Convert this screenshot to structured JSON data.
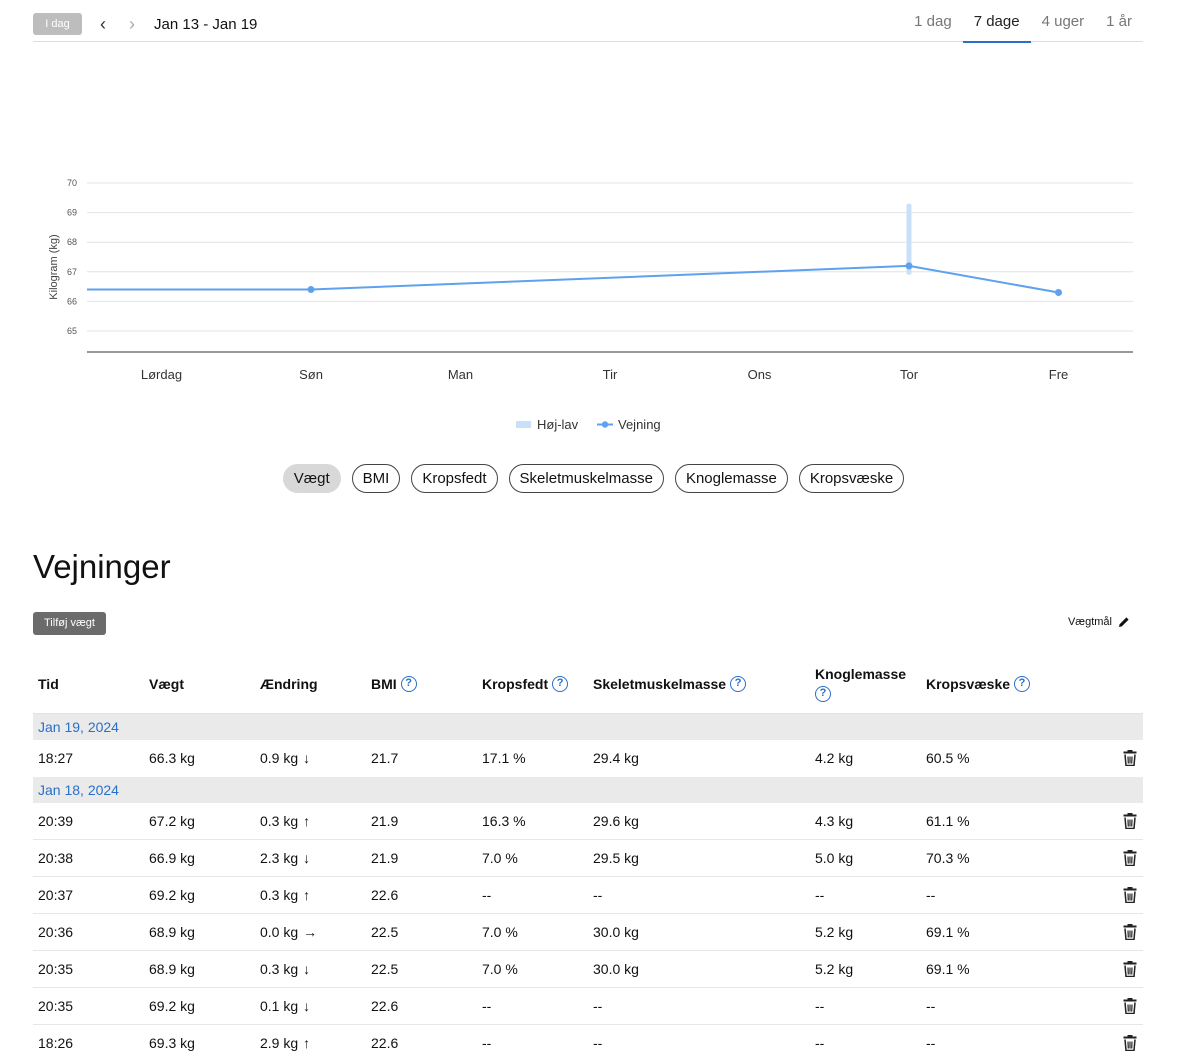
{
  "header": {
    "today_label": "I dag",
    "date_range": "Jan 13 - Jan 19",
    "range_tabs": [
      {
        "label": "1 dag",
        "active": false
      },
      {
        "label": "7 dage",
        "active": true
      },
      {
        "label": "4 uger",
        "active": false
      },
      {
        "label": "1 år",
        "active": false
      }
    ]
  },
  "chart_data": {
    "type": "line",
    "ylabel": "Kilogram (kg)",
    "ylim": [
      64.4,
      70.4
    ],
    "yticks": [
      65,
      66,
      67,
      68,
      69,
      70
    ],
    "categories": [
      "Lørdag",
      "Søn",
      "Man",
      "Tir",
      "Ons",
      "Tor",
      "Fre"
    ],
    "series": [
      {
        "name": "Vejning",
        "color": "#5ea1ee",
        "points": [
          {
            "x": "Søn",
            "y": 66.4
          },
          {
            "x": "Tor",
            "y": 67.2
          },
          {
            "x": "Fre",
            "y": 66.3
          }
        ],
        "carry_left": 66.4
      },
      {
        "name": "Høj-lav",
        "color": "#c9e0fa",
        "ranges": [
          {
            "x": "Tor",
            "low": 66.9,
            "high": 69.3
          }
        ]
      }
    ],
    "legend": [
      "Høj-lav",
      "Vejning"
    ],
    "legend_position": "bottom",
    "grid": true
  },
  "metrics": [
    {
      "label": "Vægt",
      "active": true
    },
    {
      "label": "BMI",
      "active": false
    },
    {
      "label": "Kropsfedt",
      "active": false
    },
    {
      "label": "Skeletmuskelmasse",
      "active": false
    },
    {
      "label": "Knoglemasse",
      "active": false
    },
    {
      "label": "Kropsvæske",
      "active": false
    }
  ],
  "section": {
    "title": "Vejninger",
    "add_label": "Tilføj vægt",
    "goal_label": "Vægtmål"
  },
  "table": {
    "columns": {
      "tid": "Tid",
      "vaegt": "Vægt",
      "aendring": "Ændring",
      "bmi": "BMI",
      "fedt": "Kropsfedt",
      "skelet": "Skeletmuskelmasse",
      "knogle": "Knoglemasse",
      "vaeske": "Kropsvæske"
    },
    "groups": [
      {
        "date": "Jan 19, 2024",
        "rows": [
          {
            "tid": "18:27",
            "vaegt": "66.3 kg",
            "aendring": "0.9 kg",
            "arrow": "↓",
            "bmi": "21.7",
            "fedt": "17.1 %",
            "skelet": "29.4 kg",
            "knogle": "4.2 kg",
            "vaeske": "60.5 %"
          }
        ]
      },
      {
        "date": "Jan 18, 2024",
        "rows": [
          {
            "tid": "20:39",
            "vaegt": "67.2 kg",
            "aendring": "0.3 kg",
            "arrow": "↑",
            "bmi": "21.9",
            "fedt": "16.3 %",
            "skelet": "29.6 kg",
            "knogle": "4.3 kg",
            "vaeske": "61.1 %"
          },
          {
            "tid": "20:38",
            "vaegt": "66.9 kg",
            "aendring": "2.3 kg",
            "arrow": "↓",
            "bmi": "21.9",
            "fedt": "7.0 %",
            "skelet": "29.5 kg",
            "knogle": "5.0 kg",
            "vaeske": "70.3 %"
          },
          {
            "tid": "20:37",
            "vaegt": "69.2 kg",
            "aendring": "0.3 kg",
            "arrow": "↑",
            "bmi": "22.6",
            "fedt": "--",
            "skelet": "--",
            "knogle": "--",
            "vaeske": "--"
          },
          {
            "tid": "20:36",
            "vaegt": "68.9 kg",
            "aendring": "0.0 kg",
            "arrow": "→",
            "bmi": "22.5",
            "fedt": "7.0 %",
            "skelet": "30.0 kg",
            "knogle": "5.2 kg",
            "vaeske": "69.1 %"
          },
          {
            "tid": "20:35",
            "vaegt": "68.9 kg",
            "aendring": "0.3 kg",
            "arrow": "↓",
            "bmi": "22.5",
            "fedt": "7.0 %",
            "skelet": "30.0 kg",
            "knogle": "5.2 kg",
            "vaeske": "69.1 %"
          },
          {
            "tid": "20:35",
            "vaegt": "69.2 kg",
            "aendring": "0.1 kg",
            "arrow": "↓",
            "bmi": "22.6",
            "fedt": "--",
            "skelet": "--",
            "knogle": "--",
            "vaeske": "--"
          },
          {
            "tid": "18:26",
            "vaegt": "69.3 kg",
            "aendring": "2.9 kg",
            "arrow": "↑",
            "bmi": "22.6",
            "fedt": "--",
            "skelet": "--",
            "knogle": "--",
            "vaeske": "--"
          }
        ]
      }
    ]
  }
}
